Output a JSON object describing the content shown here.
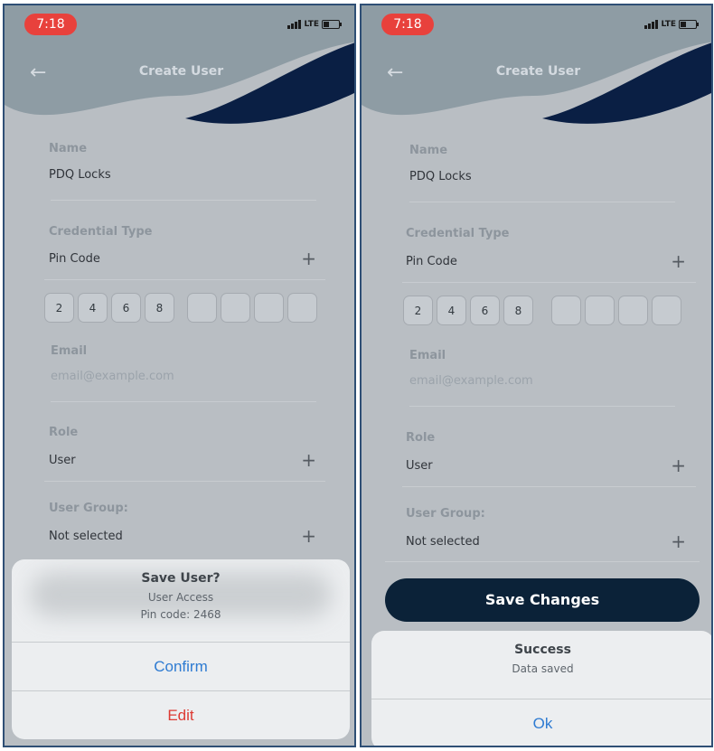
{
  "colors": {
    "header_wave_light": "#8e9ca4",
    "header_wave_dark": "#0a1f44",
    "overlay_bg": "#b9bec3",
    "status_pill": "#e8413c",
    "save_button": "#0b2238",
    "alert_blue": "#2e7bd2",
    "alert_red": "#dd3a33"
  },
  "screens": [
    {
      "status": {
        "time": "7:18",
        "network": "LTE"
      },
      "header": {
        "back_icon": "back-arrow-icon",
        "title": "Create User"
      },
      "form": {
        "name_label": "Name",
        "name_value": "PDQ Locks",
        "credential_label": "Credential Type",
        "credential_value": "Pin Code",
        "pin_digits": [
          "2",
          "4",
          "6",
          "8",
          "",
          "",
          "",
          ""
        ],
        "email_label": "Email",
        "email_placeholder": "email@example.com",
        "role_label": "Role",
        "role_value": "User",
        "group_label": "User Group:",
        "group_value": "Not selected"
      },
      "alert": {
        "title": "Save User?",
        "message_line1": "User Access",
        "message_line2": "Pin code: 2468",
        "confirm_label": "Confirm",
        "edit_label": "Edit"
      }
    },
    {
      "status": {
        "time": "7:18",
        "network": "LTE"
      },
      "header": {
        "back_icon": "back-arrow-icon",
        "title": "Create User"
      },
      "form": {
        "name_label": "Name",
        "name_value": "PDQ Locks",
        "credential_label": "Credential Type",
        "credential_value": "Pin Code",
        "pin_digits": [
          "2",
          "4",
          "6",
          "8",
          "",
          "",
          "",
          ""
        ],
        "email_label": "Email",
        "email_placeholder": "email@example.com",
        "role_label": "Role",
        "role_value": "User",
        "group_label": "User Group:",
        "group_value": "Not selected"
      },
      "save_button_label": "Save Changes",
      "alert": {
        "title": "Success",
        "message": "Data saved",
        "ok_label": "Ok"
      }
    }
  ]
}
